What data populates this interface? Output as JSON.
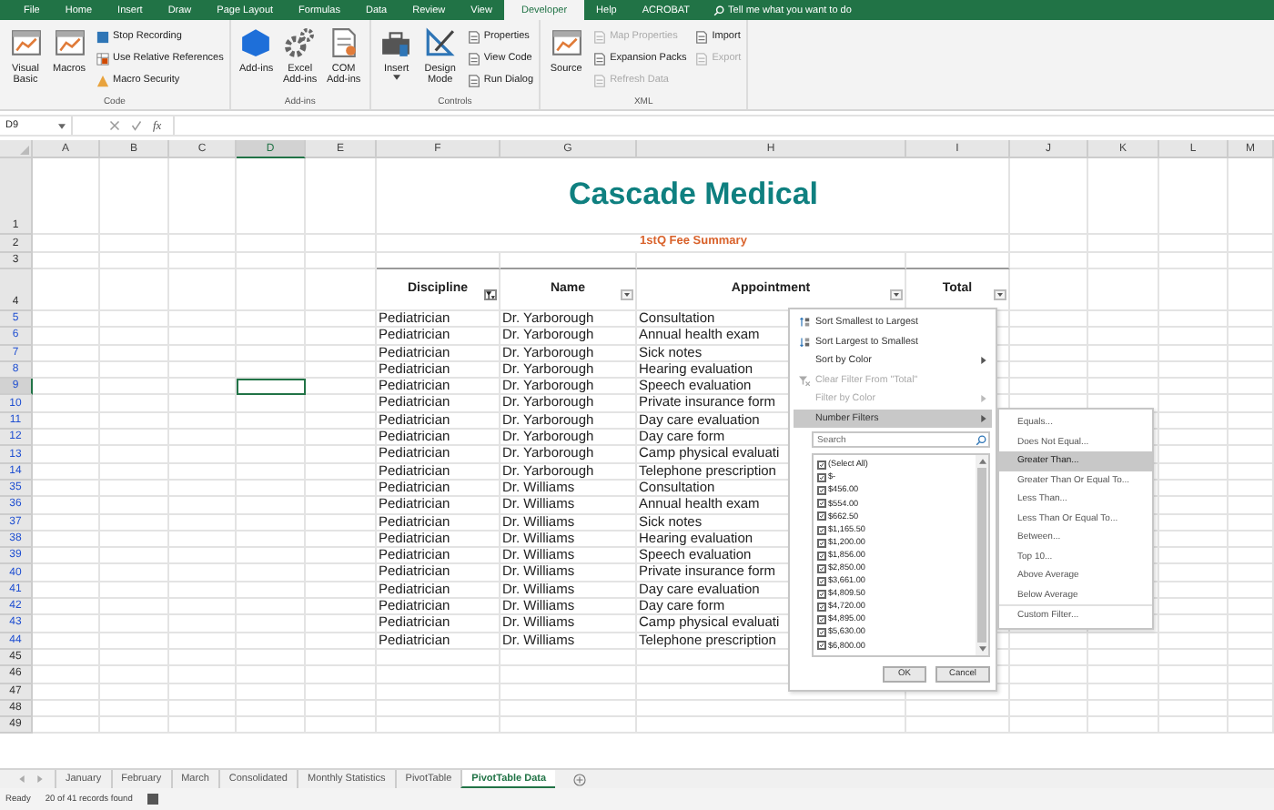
{
  "ribbon_tabs": [
    {
      "label": "File",
      "selected": false
    },
    {
      "label": "Home",
      "selected": false
    },
    {
      "label": "Insert",
      "selected": false
    },
    {
      "label": "Draw",
      "selected": false
    },
    {
      "label": "Page Layout",
      "selected": false
    },
    {
      "label": "Formulas",
      "selected": false
    },
    {
      "label": "Data",
      "selected": false
    },
    {
      "label": "Review",
      "selected": false
    },
    {
      "label": "View",
      "selected": false
    },
    {
      "label": "Developer",
      "selected": true
    },
    {
      "label": "Help",
      "selected": false
    },
    {
      "label": "ACROBAT",
      "selected": false
    }
  ],
  "tell_me": {
    "placeholder": "Tell me what you want to do"
  },
  "ribbon_groups": [
    {
      "label": "Code",
      "items": [
        {
          "label": "Visual Basic",
          "kind": "large",
          "disabled": false
        },
        {
          "label": "Macros",
          "kind": "large",
          "disabled": false
        },
        {
          "label": "Stop Recording",
          "kind": "small",
          "disabled": false
        },
        {
          "label": "Use Relative References",
          "kind": "small",
          "disabled": false
        },
        {
          "label": "Macro Security",
          "kind": "small",
          "disabled": false
        }
      ]
    },
    {
      "label": "Add-ins",
      "items": [
        {
          "label": "Add-ins",
          "kind": "large",
          "disabled": false
        },
        {
          "label": "Excel Add-ins",
          "kind": "large",
          "disabled": false
        },
        {
          "label": "COM Add-ins",
          "kind": "large",
          "disabled": false
        }
      ]
    },
    {
      "label": "Controls",
      "items": [
        {
          "label": "Insert",
          "kind": "large",
          "disabled": false,
          "dropdown": true
        },
        {
          "label": "Design Mode",
          "kind": "large",
          "disabled": false
        },
        {
          "label": "Properties",
          "kind": "small",
          "disabled": false
        },
        {
          "label": "View Code",
          "kind": "small",
          "disabled": false
        },
        {
          "label": "Run Dialog",
          "kind": "small",
          "disabled": false
        }
      ]
    },
    {
      "label": "XML",
      "items": [
        {
          "label": "Source",
          "kind": "large",
          "disabled": false
        },
        {
          "label": "Map Properties",
          "kind": "small",
          "disabled": true
        },
        {
          "label": "Expansion Packs",
          "kind": "small",
          "disabled": false
        },
        {
          "label": "Refresh Data",
          "kind": "small",
          "disabled": true
        },
        {
          "label": "Import",
          "kind": "small",
          "disabled": false
        },
        {
          "label": "Export",
          "kind": "small",
          "disabled": true
        }
      ]
    }
  ],
  "formula_bar": {
    "name_box": "D9",
    "function_label": "fx"
  },
  "sheet": {
    "columns": [
      {
        "label": "A",
        "selected": false
      },
      {
        "label": "B",
        "selected": false
      },
      {
        "label": "C",
        "selected": false
      },
      {
        "label": "D",
        "selected": true
      },
      {
        "label": "E",
        "selected": false
      },
      {
        "label": "F",
        "selected": false
      },
      {
        "label": "G",
        "selected": false
      },
      {
        "label": "H",
        "selected": false
      },
      {
        "label": "I",
        "selected": false
      },
      {
        "label": "J",
        "selected": false
      },
      {
        "label": "K",
        "selected": false
      },
      {
        "label": "L",
        "selected": false
      },
      {
        "label": "M",
        "selected": false
      }
    ],
    "top_rows": [
      "1",
      "2",
      "3",
      "4"
    ],
    "title": "Cascade Medical",
    "subtitle": "1stQ Fee Summary",
    "headers": [
      {
        "label": "Discipline",
        "filter_applied": true
      },
      {
        "label": "Name",
        "filter_applied": false
      },
      {
        "label": "Appointment",
        "filter_applied": false
      },
      {
        "label": "Total",
        "filter_applied": false
      }
    ],
    "rows": [
      {
        "number": "5",
        "filtered": true,
        "selected": false,
        "cells": [
          "Pediatrician",
          "Dr. Yarborough",
          "Consultation"
        ]
      },
      {
        "number": "6",
        "filtered": true,
        "selected": false,
        "cells": [
          "Pediatrician",
          "Dr. Yarborough",
          "Annual health exam"
        ]
      },
      {
        "number": "7",
        "filtered": true,
        "selected": false,
        "cells": [
          "Pediatrician",
          "Dr. Yarborough",
          "Sick notes"
        ]
      },
      {
        "number": "8",
        "filtered": true,
        "selected": false,
        "cells": [
          "Pediatrician",
          "Dr. Yarborough",
          "Hearing evaluation"
        ]
      },
      {
        "number": "9",
        "filtered": true,
        "selected": true,
        "cells": [
          "Pediatrician",
          "Dr. Yarborough",
          "Speech evaluation"
        ]
      },
      {
        "number": "10",
        "filtered": true,
        "selected": false,
        "cells": [
          "Pediatrician",
          "Dr. Yarborough",
          "Private insurance form"
        ]
      },
      {
        "number": "11",
        "filtered": true,
        "selected": false,
        "cells": [
          "Pediatrician",
          "Dr. Yarborough",
          "Day care evaluation"
        ]
      },
      {
        "number": "12",
        "filtered": true,
        "selected": false,
        "cells": [
          "Pediatrician",
          "Dr. Yarborough",
          "Day care form"
        ]
      },
      {
        "number": "13",
        "filtered": true,
        "selected": false,
        "cells": [
          "Pediatrician",
          "Dr. Yarborough",
          "Camp physical evaluati"
        ]
      },
      {
        "number": "14",
        "filtered": true,
        "selected": false,
        "cells": [
          "Pediatrician",
          "Dr. Yarborough",
          "Telephone prescription"
        ]
      },
      {
        "number": "35",
        "filtered": true,
        "selected": false,
        "cells": [
          "Pediatrician",
          "Dr. Williams",
          "Consultation"
        ]
      },
      {
        "number": "36",
        "filtered": true,
        "selected": false,
        "cells": [
          "Pediatrician",
          "Dr. Williams",
          "Annual health exam"
        ]
      },
      {
        "number": "37",
        "filtered": true,
        "selected": false,
        "cells": [
          "Pediatrician",
          "Dr. Williams",
          "Sick notes"
        ]
      },
      {
        "number": "38",
        "filtered": true,
        "selected": false,
        "cells": [
          "Pediatrician",
          "Dr. Williams",
          "Hearing evaluation"
        ]
      },
      {
        "number": "39",
        "filtered": true,
        "selected": false,
        "cells": [
          "Pediatrician",
          "Dr. Williams",
          "Speech evaluation"
        ]
      },
      {
        "number": "40",
        "filtered": true,
        "selected": false,
        "cells": [
          "Pediatrician",
          "Dr. Williams",
          "Private insurance form"
        ]
      },
      {
        "number": "41",
        "filtered": true,
        "selected": false,
        "cells": [
          "Pediatrician",
          "Dr. Williams",
          "Day care evaluation"
        ]
      },
      {
        "number": "42",
        "filtered": true,
        "selected": false,
        "cells": [
          "Pediatrician",
          "Dr. Williams",
          "Day care form"
        ]
      },
      {
        "number": "43",
        "filtered": true,
        "selected": false,
        "cells": [
          "Pediatrician",
          "Dr. Williams",
          "Camp physical evaluati"
        ]
      },
      {
        "number": "44",
        "filtered": true,
        "selected": false,
        "cells": [
          "Pediatrician",
          "Dr. Williams",
          "Telephone prescription"
        ]
      },
      {
        "number": "45",
        "filtered": false,
        "selected": false,
        "cells": []
      },
      {
        "number": "46",
        "filtered": false,
        "selected": false,
        "cells": []
      },
      {
        "number": "47",
        "filtered": false,
        "selected": false,
        "cells": []
      },
      {
        "number": "48",
        "filtered": false,
        "selected": false,
        "cells": []
      },
      {
        "number": "49",
        "filtered": false,
        "selected": false,
        "cells": []
      }
    ]
  },
  "filter_menu": {
    "items": [
      {
        "label": "Sort Smallest to Largest",
        "kind": "sort_ascending",
        "disabled": false,
        "submenu": false,
        "selected": false
      },
      {
        "label": "Sort Largest to Smallest",
        "kind": "sort_descending",
        "disabled": false,
        "submenu": false,
        "selected": false
      },
      {
        "label": "Sort by Color",
        "kind": "plain",
        "disabled": false,
        "submenu": true,
        "selected": false
      },
      {
        "label": "Clear Filter From \"Total\"",
        "kind": "clear_filter",
        "disabled": true,
        "submenu": false,
        "selected": false
      },
      {
        "label": "Filter by Color",
        "kind": "plain",
        "disabled": true,
        "submenu": true,
        "selected": false
      },
      {
        "label": "Number Filters",
        "kind": "plain",
        "disabled": false,
        "submenu": true,
        "selected": true
      }
    ],
    "search": {
      "placeholder": "Search"
    },
    "values": [
      {
        "label": "(Select All)",
        "checked": true
      },
      {
        "label": "$-",
        "checked": true
      },
      {
        "label": "$456.00",
        "checked": true
      },
      {
        "label": "$554.00",
        "checked": true
      },
      {
        "label": "$662.50",
        "checked": true
      },
      {
        "label": "$1,165.50",
        "checked": true
      },
      {
        "label": "$1,200.00",
        "checked": true
      },
      {
        "label": "$1,856.00",
        "checked": true
      },
      {
        "label": "$2,850.00",
        "checked": true
      },
      {
        "label": "$3,661.00",
        "checked": true
      },
      {
        "label": "$4,809.50",
        "checked": true
      },
      {
        "label": "$4,720.00",
        "checked": true
      },
      {
        "label": "$4,895.00",
        "checked": true
      },
      {
        "label": "$5,630.00",
        "checked": true
      },
      {
        "label": "$6,800.00",
        "checked": true
      }
    ],
    "buttons": [
      "OK",
      "Cancel"
    ]
  },
  "number_filters": [
    {
      "label": "Equals...",
      "selected": false,
      "separated": false
    },
    {
      "label": "Does Not Equal...",
      "selected": false,
      "separated": false
    },
    {
      "label": "Greater Than...",
      "selected": true,
      "separated": false
    },
    {
      "label": "Greater Than Or Equal To...",
      "selected": false,
      "separated": false
    },
    {
      "label": "Less Than...",
      "selected": false,
      "separated": false
    },
    {
      "label": "Less Than Or Equal To...",
      "selected": false,
      "separated": false
    },
    {
      "label": "Between...",
      "selected": false,
      "separated": false
    },
    {
      "label": "Top 10...",
      "selected": false,
      "separated": false
    },
    {
      "label": "Above Average",
      "selected": false,
      "separated": false
    },
    {
      "label": "Below Average",
      "selected": false,
      "separated": false
    },
    {
      "label": "Custom Filter...",
      "selected": false,
      "separated": true
    }
  ],
  "sheet_tabs": [
    {
      "label": "January",
      "selected": false
    },
    {
      "label": "February",
      "selected": false
    },
    {
      "label": "March",
      "selected": false
    },
    {
      "label": "Consolidated",
      "selected": false
    },
    {
      "label": "Monthly Statistics",
      "selected": false
    },
    {
      "label": "PivotTable",
      "selected": false
    },
    {
      "label": "PivotTable Data",
      "selected": true
    }
  ],
  "status_bar": {
    "mode": "Ready",
    "records": "20 of 41 records found"
  }
}
